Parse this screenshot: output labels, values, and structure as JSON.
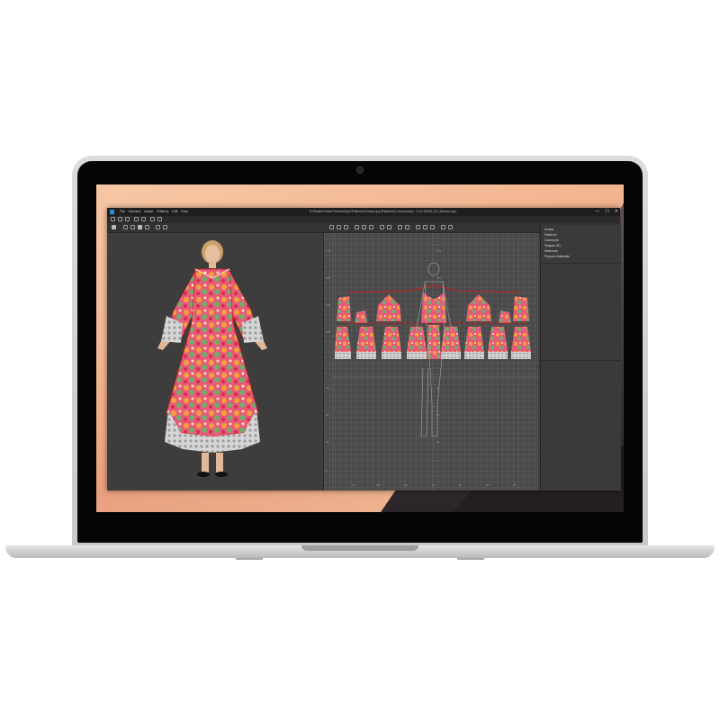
{
  "app": {
    "menu": [
      "File",
      "Garment",
      "Avatar",
      "Patterns",
      "Edit",
      "Help"
    ],
    "path": "E:/Studio/Online/Torrent/Sync/Patterns/Tunica.zprj (PatternsZ) version/zprj - CLO-SUDE-C3_Women.zprj",
    "window_controls": [
      "—",
      "☐",
      "✕"
    ]
  },
  "object_browser": {
    "items": [
      "Avatar",
      "Patterns",
      "Garments",
      "Shapes 3D",
      "Materials",
      "Physics Materials"
    ]
  },
  "pattern_window": {
    "vertical_ticks_left": [
      "175",
      "150",
      "125",
      "100",
      "75",
      "50",
      "25",
      "0"
    ],
    "vertical_ticks_center": [
      "175",
      "150",
      "125",
      "100",
      "75",
      "50",
      "25",
      "0"
    ],
    "horizontal_ticks": [
      "-75",
      "-50",
      "-25",
      "0",
      "25",
      "50",
      "75",
      "100"
    ]
  },
  "colors": {
    "app_bg": "#404040",
    "titlebar": "#1e1e1e",
    "accent_blue": "#2f8fd8",
    "seam_red": "#cc1f1f",
    "fabric_pink": "#e85a7a",
    "fabric_green": "#6fae6a",
    "lace_gray": "#c9c9c9"
  }
}
